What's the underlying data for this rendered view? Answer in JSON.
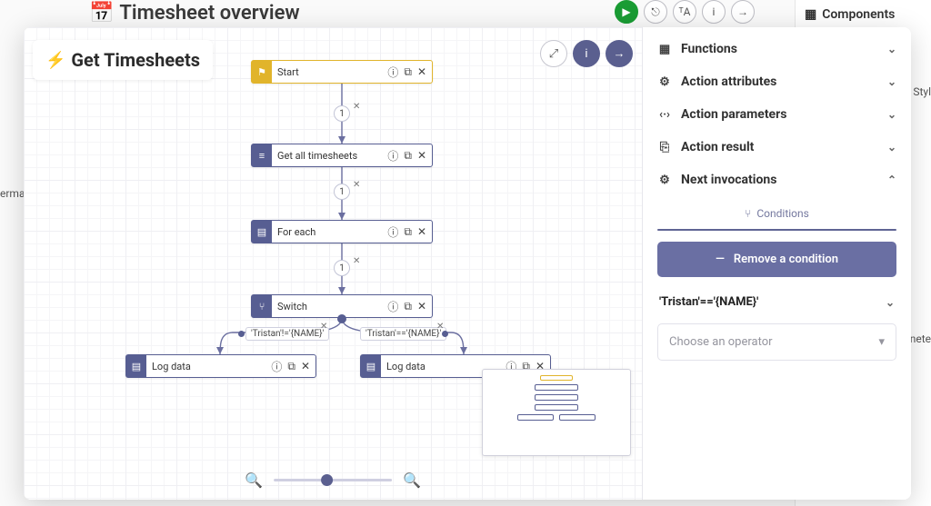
{
  "background": {
    "title": "Timesheet overview",
    "right_header": "Components",
    "right_label_1": "Styl",
    "right_label_2": "erma",
    "right_label_3": "nete"
  },
  "modal": {
    "title": "Get Timesheets",
    "toolbar": {
      "expand": "expand",
      "info": "info",
      "forward": "forward"
    }
  },
  "nodes": {
    "start": "Start",
    "get_all": "Get all timesheets",
    "foreach": "For each",
    "switch": "Switch",
    "log1": "Log data",
    "log2": "Log data"
  },
  "edges": {
    "badge1": "1",
    "badge2": "1",
    "badge3": "1",
    "cond_false": "'Tristan'!='{NAME}'",
    "cond_true": "'Tristan'=='{NAME}'"
  },
  "panel": {
    "sections": {
      "functions": "Functions",
      "attributes": "Action attributes",
      "parameters": "Action parameters",
      "result": "Action result",
      "next": "Next invocations"
    },
    "conditions_tab": "Conditions",
    "remove_label": "Remove a condition",
    "condition_expr": "'Tristan'=='{NAME}'",
    "operator_placeholder": "Choose an operator"
  },
  "zoom": {
    "out": "−",
    "in": "+"
  }
}
